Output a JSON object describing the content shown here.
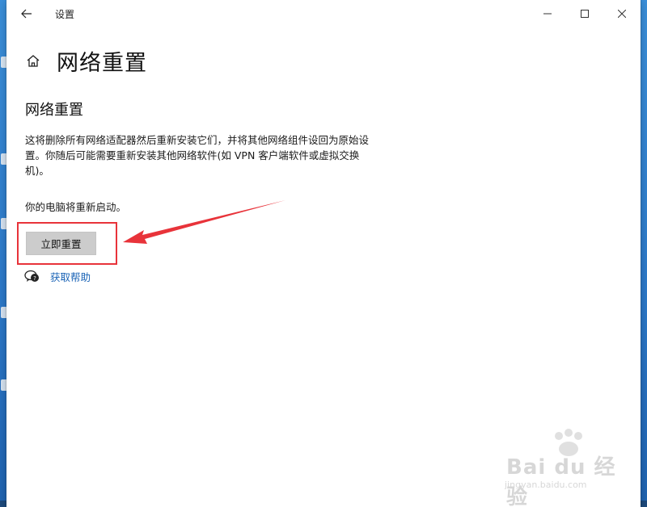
{
  "window": {
    "title": "设置",
    "controls": {
      "minimize": "minimize-icon",
      "maximize": "maximize-icon",
      "close": "close-icon"
    }
  },
  "page": {
    "title": "网络重置"
  },
  "section": {
    "title": "网络重置",
    "description": "这将删除所有网络适配器然后重新安装它们，并将其他网络组件设回为原始设置。你随后可能需要重新安装其他网络软件(如 VPN 客户端软件或虚拟交换机)。",
    "restart_note": "你的电脑将重新启动。",
    "reset_button_label": "立即重置",
    "help_link_label": "获取帮助"
  },
  "annotation": {
    "highlight_color": "#e8333a"
  },
  "watermark": {
    "logo_text": "Bai du 经验",
    "url": "jingyan.baidu.com"
  },
  "colors": {
    "accent_link": "#1a63b6",
    "button_bg": "#cccccc"
  }
}
